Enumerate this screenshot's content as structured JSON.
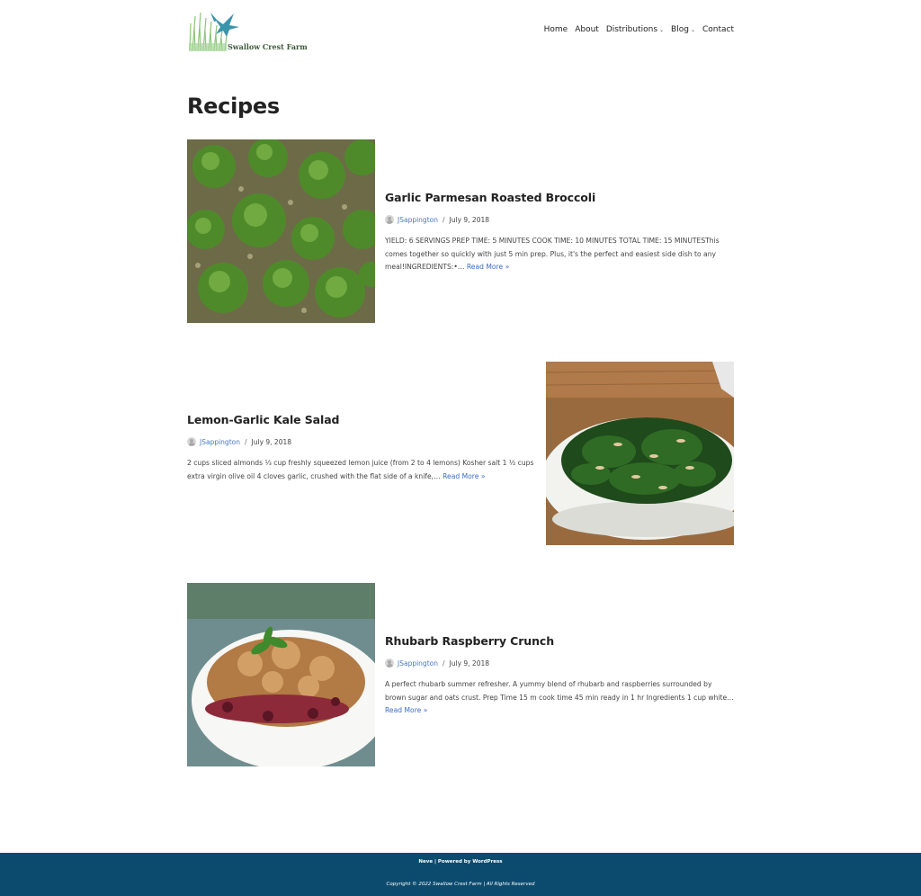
{
  "site": {
    "logo_text": "Swallow Crest Farm"
  },
  "nav": [
    {
      "label": "Home"
    },
    {
      "label": "About"
    },
    {
      "label": "Distributions"
    },
    {
      "label": "Blog"
    },
    {
      "label": "Contact"
    }
  ],
  "page_title": "Recipes",
  "posts": [
    {
      "title": "Garlic Parmesan Roasted Broccoli",
      "author": "JSappington",
      "separator": "/",
      "date": "July 9, 2018",
      "excerpt": "YIELD: 6 SERVINGS PREP TIME: 5 MINUTES COOK TIME: 10 MINUTES TOTAL TIME: 15 MINUTESThis comes together so quickly with just 5 min prep. Plus, it's the perfect and easiest side dish to any meal!INGREDIENTS:•…",
      "read_more": "Read More »",
      "image": "broccoli-photo"
    },
    {
      "title": "Lemon-Garlic Kale Salad",
      "author": "JSappington",
      "separator": "/",
      "date": "July 9, 2018",
      "excerpt": "2 cups sliced almonds ⅓ cup freshly squeezed lemon juice (from 2 to 4 lemons) Kosher salt 1 ½ cups extra virgin olive oil 4 cloves garlic, crushed with the flat side of a knife,…",
      "read_more": "Read More »",
      "image": "kale-salad-photo"
    },
    {
      "title": "Rhubarb Raspberry Crunch",
      "author": "JSappington",
      "separator": "/",
      "date": "July 9, 2018",
      "excerpt": "A perfect rhubarb summer refresher. A yummy blend of rhubarb and raspberries surrounded by brown sugar and oats crust. Prep Time 15 m cook time 45 min ready in 1 hr Ingredients 1 cup white…",
      "read_more": "Read More »",
      "image": "rhubarb-crunch-photo"
    }
  ],
  "footer": {
    "credits": "Neve | Powered by WordPress",
    "copyright": "Copyright © 2022 Swallow Crest Farm | All Rights Reserved"
  },
  "colors": {
    "footer_bg": "#0c4b6e",
    "link": "#3e6cc0",
    "heading": "#222222"
  }
}
